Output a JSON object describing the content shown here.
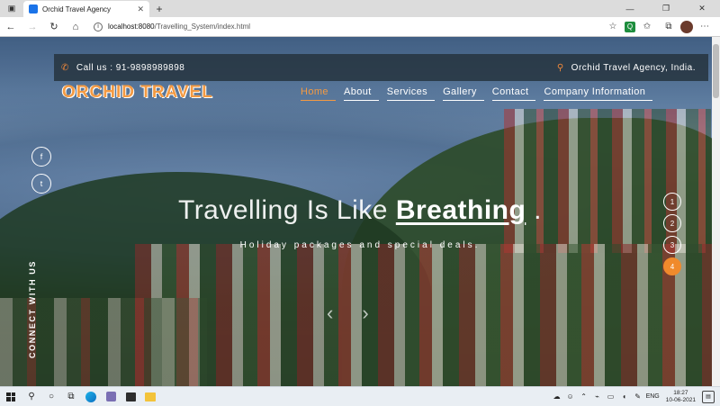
{
  "browser": {
    "tab_title": "Orchid Travel Agency",
    "new_tab": "+",
    "url_host": "localhost:8080",
    "url_path": "/Travelling_System/index.html",
    "window_controls": [
      "—",
      "❐",
      "✕"
    ],
    "ext_q_label": "Q"
  },
  "topbar": {
    "phone": "Call us : 91-9898989898",
    "location": "Orchid Travel Agency, India."
  },
  "brand": "ORCHID TRAVEL",
  "nav": {
    "home": "Home",
    "about": "About",
    "services": "Services",
    "gallery": "Gallery",
    "contact": "Contact",
    "company": "Company Information"
  },
  "social": {
    "facebook": "f",
    "twitter": "t",
    "connect_label": "CONNECT WITH US"
  },
  "hero": {
    "lead": "Travelling Is Like",
    "strong": "Breathing",
    "tail": ".",
    "subtitle": "Holiday packages and special deals."
  },
  "slider": {
    "prev": "‹",
    "next": "›",
    "pages": [
      "1",
      "2",
      "3",
      "4"
    ],
    "active_page": "4"
  },
  "taskbar": {
    "lang": "ENG",
    "time": "18:27",
    "date": "10-06-2021"
  },
  "colors": {
    "accent": "#f39a43",
    "dot_active": "#f08a2c"
  }
}
